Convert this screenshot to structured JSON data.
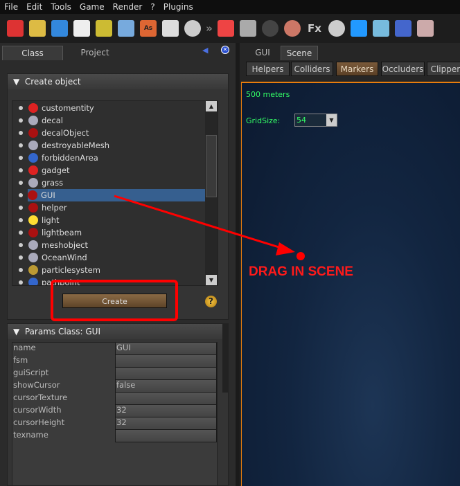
{
  "menu": [
    "File",
    "Edit",
    "Tools",
    "Game",
    "Render",
    "?",
    "Plugins"
  ],
  "toolbar_icons": [
    "s2-new-icon",
    "s2-open-icon",
    "s2-save-icon",
    "new-file-icon",
    "open-folder-icon",
    "save-icon",
    "save-as-icon",
    "import-icon",
    "cd-icon",
    "more-icon",
    "cube-icon",
    "terrain-icon",
    "tire-icon",
    "sphere-icon",
    "fx-icon",
    "film-reel-icon",
    "flag-icon",
    "notes-icon",
    "hierarchy-icon",
    "clipboard-icon"
  ],
  "toolbar_text": {
    "more": "»",
    "fx": "Fx",
    "as": "As"
  },
  "left_tabs": [
    "Class",
    "Project"
  ],
  "create_section": {
    "title": "Create object",
    "create_label": "Create",
    "help": "?"
  },
  "classes": [
    {
      "name": "customentity",
      "icon": "entity-icon",
      "color": "#d22"
    },
    {
      "name": "decal",
      "icon": "mesh-icon",
      "color": "#aab"
    },
    {
      "name": "decalObject",
      "icon": "object-icon",
      "color": "#a11"
    },
    {
      "name": "destroyableMesh",
      "icon": "mesh-icon",
      "color": "#aab"
    },
    {
      "name": "forbiddenArea",
      "icon": "area-icon",
      "color": "#36c"
    },
    {
      "name": "gadget",
      "icon": "entity-icon",
      "color": "#d22"
    },
    {
      "name": "grass",
      "icon": "mesh-icon",
      "color": "#aab"
    },
    {
      "name": "GUI",
      "icon": "object-icon",
      "color": "#a11",
      "selected": true
    },
    {
      "name": "helper",
      "icon": "object-icon",
      "color": "#a11"
    },
    {
      "name": "light",
      "icon": "lightbulb-icon",
      "color": "#fd3"
    },
    {
      "name": "lightbeam",
      "icon": "object-icon",
      "color": "#a11"
    },
    {
      "name": "meshobject",
      "icon": "mesh-icon",
      "color": "#aab"
    },
    {
      "name": "OceanWind",
      "icon": "mesh-icon",
      "color": "#aab"
    },
    {
      "name": "particlesystem",
      "icon": "particle-icon",
      "color": "#b93"
    },
    {
      "name": "pathpoint",
      "icon": "area-icon",
      "color": "#36c"
    }
  ],
  "params": {
    "title": "Params Class: GUI",
    "rows": [
      {
        "key": "name",
        "value": "GUI"
      },
      {
        "key": "fsm",
        "value": ""
      },
      {
        "key": "guiScript",
        "value": ""
      },
      {
        "key": "showCursor",
        "value": "false"
      },
      {
        "key": "cursorTexture",
        "value": ""
      },
      {
        "key": "cursorWidth",
        "value": "32"
      },
      {
        "key": "cursorHeight",
        "value": "32"
      },
      {
        "key": "texname",
        "value": ""
      }
    ]
  },
  "right_tabs": [
    "GUI",
    "Scene"
  ],
  "filters": [
    {
      "label": "Helpers"
    },
    {
      "label": "Colliders"
    },
    {
      "label": "Markers",
      "active": true
    },
    {
      "label": "Occluders"
    },
    {
      "label": "Clippers"
    }
  ],
  "scene": {
    "scale": "500 meters",
    "grid_label": "GridSize:",
    "grid_value": "54"
  },
  "annotation": {
    "text": "DRAG IN SCENE",
    "color": "#ff1a1a"
  }
}
